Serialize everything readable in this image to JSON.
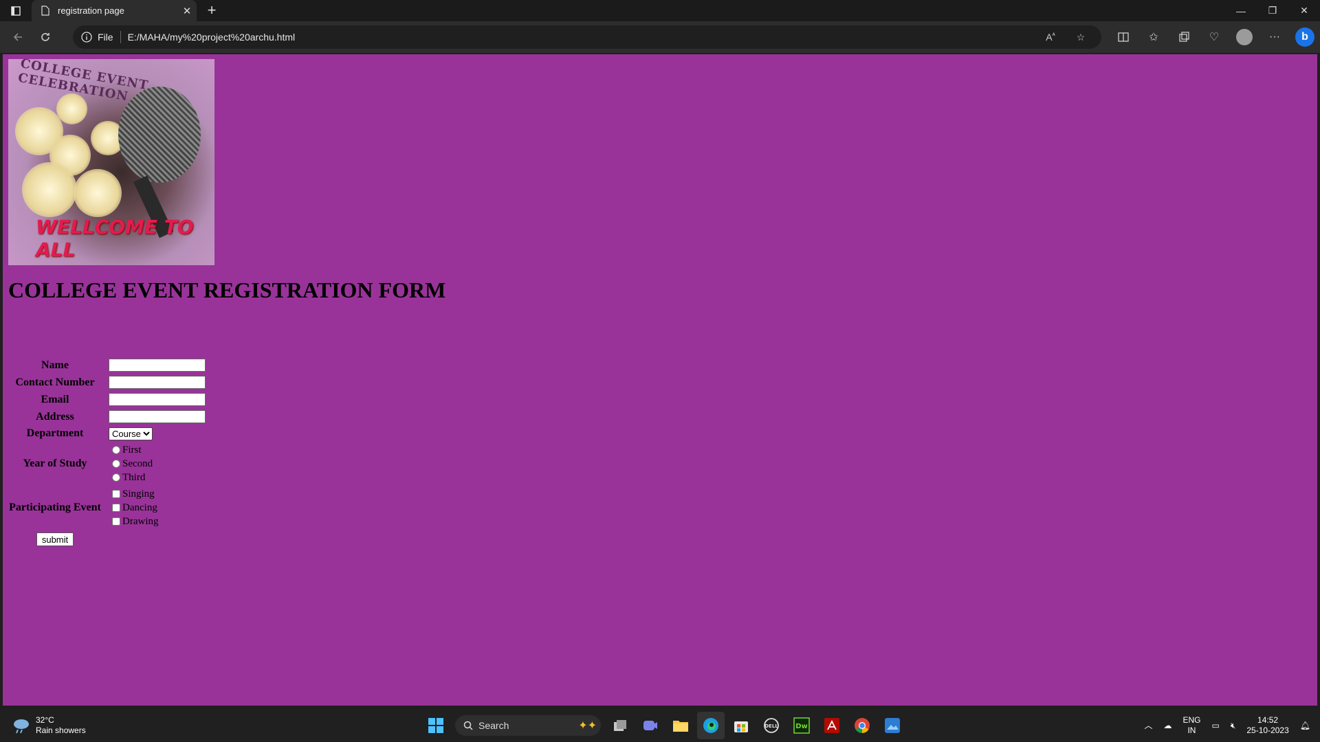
{
  "browser": {
    "tab_title": "registration page",
    "address_prefix": "File",
    "url": "E:/MAHA/my%20project%20archu.html"
  },
  "page": {
    "banner_top_text": "COLLEGE EVENT CELEBRATION",
    "banner_bottom_text": "WELLCOME TO ALL",
    "heading": "COLLEGE EVENT REGISTRATION FORM",
    "form": {
      "name_label": "Name",
      "contact_label": "Contact Number",
      "email_label": "Email",
      "address_label": "Address",
      "department_label": "Department",
      "department_selected": "Course",
      "year_label": "Year of Study",
      "years": [
        "First",
        "Second",
        "Third"
      ],
      "event_label": "Participating Event",
      "events": [
        "Singing",
        "Dancing",
        "Drawing"
      ],
      "submit_label": "submit"
    }
  },
  "taskbar": {
    "temperature": "32°C",
    "weather": "Rain showers",
    "search_placeholder": "Search",
    "lang_top": "ENG",
    "lang_bottom": "IN",
    "time": "14:52",
    "date": "25-10-2023"
  }
}
